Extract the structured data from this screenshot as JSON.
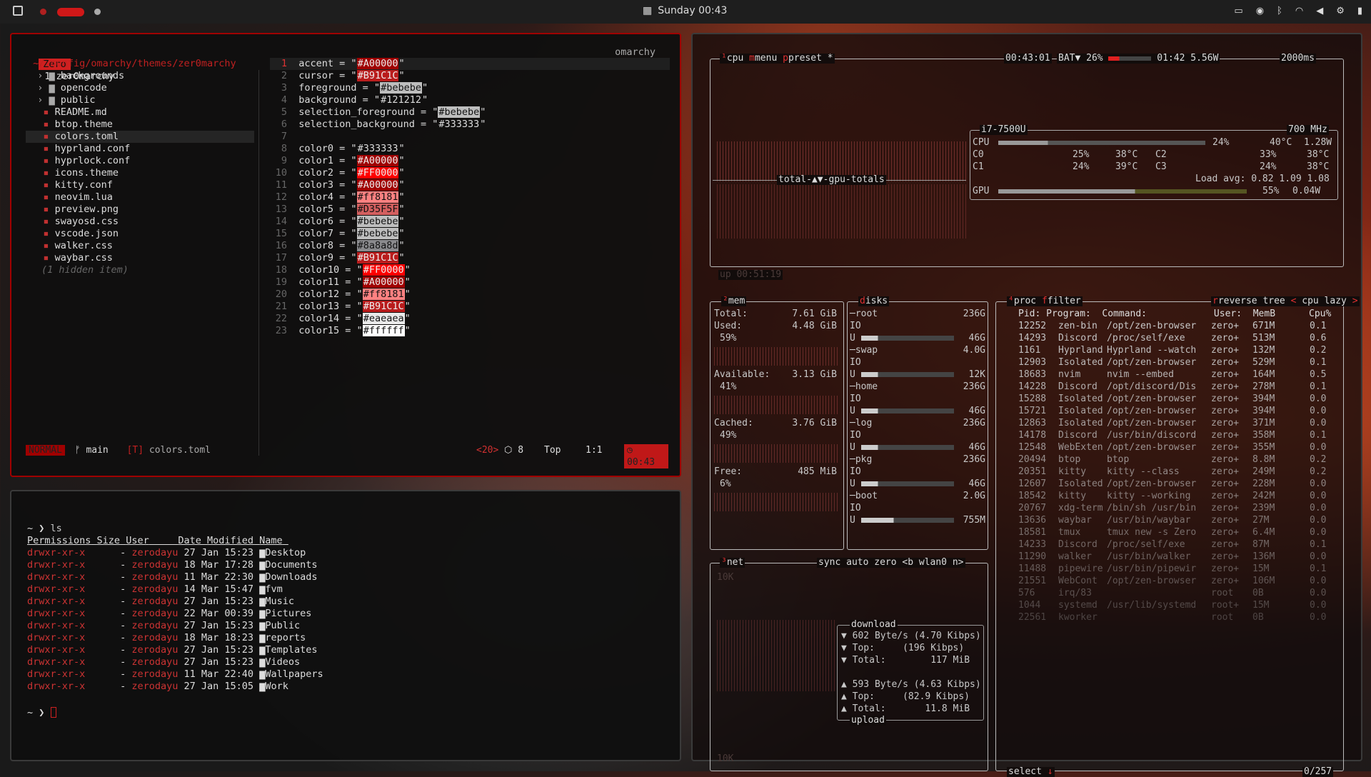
{
  "bar": {
    "clock": "Sunday 00:43"
  },
  "editor": {
    "tab_label": "Zero",
    "tab_title": "1:zer0marchy",
    "right_label": "omarchy",
    "path": " ~/.config/omarchy/themes/zer0marchy",
    "tree": [
      {
        "name": "backgrounds",
        "kind": "dir"
      },
      {
        "name": "opencode",
        "kind": "dir"
      },
      {
        "name": "public",
        "kind": "dir"
      },
      {
        "name": "README.md",
        "kind": "file"
      },
      {
        "name": "btop.theme",
        "kind": "file"
      },
      {
        "name": "colors.toml",
        "kind": "file",
        "sel": true
      },
      {
        "name": "hyprland.conf",
        "kind": "file"
      },
      {
        "name": "hyprlock.conf",
        "kind": "file"
      },
      {
        "name": "icons.theme",
        "kind": "file"
      },
      {
        "name": "kitty.conf",
        "kind": "file"
      },
      {
        "name": "neovim.lua",
        "kind": "file"
      },
      {
        "name": "preview.png",
        "kind": "file"
      },
      {
        "name": "swayosd.css",
        "kind": "file"
      },
      {
        "name": "vscode.json",
        "kind": "file"
      },
      {
        "name": "walker.css",
        "kind": "file"
      },
      {
        "name": "waybar.css",
        "kind": "file"
      }
    ],
    "hidden_note": "(1 hidden item)",
    "lines": [
      {
        "n": "1",
        "k": "accent",
        "v": "#A00000",
        "c": "#A00000"
      },
      {
        "n": "2",
        "k": "cursor",
        "v": "#B91C1C",
        "c": "#B91C1C"
      },
      {
        "n": "3",
        "k": "foreground",
        "v": "#bebebe",
        "c": "#bebebe"
      },
      {
        "n": "4",
        "k": "background",
        "v": "#121212",
        "c": ""
      },
      {
        "n": "5",
        "k": "selection_foreground",
        "v": "#bebebe",
        "c": "#bebebe"
      },
      {
        "n": "6",
        "k": "selection_background",
        "v": "#333333",
        "c": ""
      },
      {
        "n": "7",
        "k": "",
        "v": "",
        "c": ""
      },
      {
        "n": "8",
        "k": "color0",
        "v": "#333333",
        "c": ""
      },
      {
        "n": "9",
        "k": "color1",
        "v": "#A00000",
        "c": "#A00000"
      },
      {
        "n": "10",
        "k": "color2",
        "v": "#FF0000",
        "c": "#FF0000"
      },
      {
        "n": "11",
        "k": "color3",
        "v": "#A00000",
        "c": "#A00000"
      },
      {
        "n": "12",
        "k": "color4",
        "v": "#ff8181",
        "c": "#ff8181"
      },
      {
        "n": "13",
        "k": "color5",
        "v": "#D35F5F",
        "c": "#D35F5F"
      },
      {
        "n": "14",
        "k": "color6",
        "v": "#bebebe",
        "c": "#bebebe"
      },
      {
        "n": "15",
        "k": "color7",
        "v": "#bebebe",
        "c": "#bebebe"
      },
      {
        "n": "16",
        "k": "color8",
        "v": "#8a8a8d",
        "c": "#8a8a8d"
      },
      {
        "n": "17",
        "k": "color9",
        "v": "#B91C1C",
        "c": "#B91C1C"
      },
      {
        "n": "18",
        "k": "color10",
        "v": "#FF0000",
        "c": "#FF0000"
      },
      {
        "n": "19",
        "k": "color11",
        "v": "#A00000",
        "c": "#A00000"
      },
      {
        "n": "20",
        "k": "color12",
        "v": "#ff8181",
        "c": "#ff8181"
      },
      {
        "n": "21",
        "k": "color13",
        "v": "#B91C1C",
        "c": "#B91C1C"
      },
      {
        "n": "22",
        "k": "color14",
        "v": "#eaeaea",
        "c": "#eaeaea"
      },
      {
        "n": "23",
        "k": "color15",
        "v": "#ffffff",
        "c": "#ffffff"
      }
    ],
    "status": {
      "mode": "NORMAL",
      "branch": "main",
      "file": "colors.toml",
      "count": "<20>",
      "lsp": "8",
      "pos": "Top",
      "cursor": "1:1",
      "time": "00:43"
    }
  },
  "term": {
    "cmd": "ls",
    "headers": [
      "Permissions",
      "Size",
      "User",
      "Date Modified",
      "Name"
    ],
    "rows": [
      [
        "drwxr-xr-x",
        "-",
        "zerodayu",
        "27 Jan 15:23",
        "Desktop"
      ],
      [
        "drwxr-xr-x",
        "-",
        "zerodayu",
        "18 Mar 17:28",
        "Documents"
      ],
      [
        "drwxr-xr-x",
        "-",
        "zerodayu",
        "11 Mar 22:30",
        "Downloads"
      ],
      [
        "drwxr-xr-x",
        "-",
        "zerodayu",
        "14 Mar 15:47",
        "fvm"
      ],
      [
        "drwxr-xr-x",
        "-",
        "zerodayu",
        "27 Jan 15:23",
        "Music"
      ],
      [
        "drwxr-xr-x",
        "-",
        "zerodayu",
        "22 Mar 00:39",
        "Pictures"
      ],
      [
        "drwxr-xr-x",
        "-",
        "zerodayu",
        "27 Jan 15:23",
        "Public"
      ],
      [
        "drwxr-xr-x",
        "-",
        "zerodayu",
        "18 Mar 18:23",
        "reports"
      ],
      [
        "drwxr-xr-x",
        "-",
        "zerodayu",
        "27 Jan 15:23",
        "Templates"
      ],
      [
        "drwxr-xr-x",
        "-",
        "zerodayu",
        "27 Jan 15:23",
        "Videos"
      ],
      [
        "drwxr-xr-x",
        "-",
        "zerodayu",
        "11 Mar 22:40",
        "Wallpapers"
      ],
      [
        "drwxr-xr-x",
        "-",
        "zerodayu",
        "27 Jan 15:05",
        "Work"
      ]
    ]
  },
  "btop": {
    "cpu_tabs": [
      "cpu",
      "menu",
      "preset *"
    ],
    "clock": "00:43:01",
    "bat": "BAT▼ 26%",
    "batstat": "01:42 5.56W",
    "interval": "2000ms",
    "cpu_name": "i7-7500U",
    "mhz": "700 MHz",
    "cpu_pct": "24%",
    "cpu_temp": "40°C",
    "cpu_watt": "1.28W",
    "c0": "25%",
    "c0t": "38°C",
    "c1": "24%",
    "c1t": "39°C",
    "c2": "33%",
    "c2t": "38°C",
    "c3": "24%",
    "c3t": "38°C",
    "load": "Load avg: 0.82 1.09 1.08",
    "gpu_pct": "55%",
    "gpu_watt": "0.04W",
    "gpu_label": "total-▲▼-gpu-totals",
    "uptime": "up 00:51:19",
    "mem": {
      "title": "mem",
      "total_l": "Total:",
      "total": "7.61 GiB",
      "used_l": "Used:",
      "used": "4.48 GiB",
      "used_p": "59%",
      "avail_l": "Available:",
      "avail": "3.13 GiB",
      "avail_p": "41%",
      "cached_l": "Cached:",
      "cached": "3.76 GiB",
      "cached_p": "49%",
      "free_l": "Free:",
      "free": "485 MiB",
      "free_p": "6%"
    },
    "disks": [
      {
        "name": "root",
        "size": "236G",
        "used": "46G"
      },
      {
        "name": "swap",
        "size": "4.0G",
        "used": "12K"
      },
      {
        "name": "home",
        "size": "236G",
        "used": "46G"
      },
      {
        "name": "log",
        "size": "236G",
        "used": "46G"
      },
      {
        "name": "pkg",
        "size": "236G",
        "used": "46G"
      },
      {
        "name": "boot",
        "size": "2.0G",
        "used": "755M"
      }
    ],
    "net": {
      "title": "net",
      "tabs": "sync auto zero <b wlan0 n>",
      "down_title": "download",
      "down": "602 Byte/s (4.70 Kibps)",
      "down_top": "(196 Kibps)",
      "down_total": "117 MiB",
      "up": "593 Byte/s (4.63 Kibps)",
      "up_top": "(82.9 Kibps)",
      "up_total": "11.8 MiB",
      "up_title": "upload",
      "scale": "10K"
    },
    "proc": {
      "title": "proc",
      "filter": "filter",
      "reverse": "reverse",
      "tree": "tree",
      "sort": "cpu lazy",
      "headers": "Pid: Program:  Command:            User:  MemB      Cpu%",
      "rows": [
        [
          "12252",
          "zen-bin",
          "/opt/zen-browser",
          "zero+",
          "671M",
          "0.1"
        ],
        [
          "14293",
          "Discord",
          "/proc/self/exe",
          "zero+",
          "513M",
          "0.6"
        ],
        [
          "1161",
          "Hyprland",
          "Hyprland --watch",
          "zero+",
          "132M",
          "0.2"
        ],
        [
          "12903",
          "Isolated",
          "/opt/zen-browser",
          "zero+",
          "529M",
          "0.1"
        ],
        [
          "18683",
          "nvim",
          "nvim --embed",
          "zero+",
          "164M",
          "0.5"
        ],
        [
          "14228",
          "Discord",
          "/opt/discord/Dis",
          "zero+",
          "278M",
          "0.1"
        ],
        [
          "15288",
          "Isolated",
          "/opt/zen-browser",
          "zero+",
          "394M",
          "0.0"
        ],
        [
          "15721",
          "Isolated",
          "/opt/zen-browser",
          "zero+",
          "394M",
          "0.0"
        ],
        [
          "12863",
          "Isolated",
          "/opt/zen-browser",
          "zero+",
          "371M",
          "0.0"
        ],
        [
          "14178",
          "Discord",
          "/usr/bin/discord",
          "zero+",
          "358M",
          "0.1"
        ],
        [
          "12548",
          "WebExten",
          "/opt/zen-browser",
          "zero+",
          "355M",
          "0.0"
        ],
        [
          "20494",
          "btop",
          "btop",
          "zero+",
          "8.8M",
          "0.2"
        ],
        [
          "20351",
          "kitty",
          "kitty --class",
          "zero+",
          "249M",
          "0.2"
        ],
        [
          "12607",
          "Isolated",
          "/opt/zen-browser",
          "zero+",
          "228M",
          "0.0"
        ],
        [
          "18542",
          "kitty",
          "kitty --working",
          "zero+",
          "242M",
          "0.0"
        ],
        [
          "20767",
          "xdg-term",
          "/bin/sh /usr/bin",
          "zero+",
          "239M",
          "0.0"
        ],
        [
          "13636",
          "waybar",
          "/usr/bin/waybar",
          "zero+",
          "27M",
          "0.0"
        ],
        [
          "18581",
          "tmux",
          "tmux new -s Zero",
          "zero+",
          "6.4M",
          "0.0"
        ],
        [
          "14233",
          "Discord",
          "/proc/self/exe",
          "zero+",
          "87M",
          "0.1"
        ],
        [
          "11290",
          "walker",
          "/usr/bin/walker",
          "zero+",
          "136M",
          "0.0"
        ],
        [
          "11488",
          "pipewire",
          "/usr/bin/pipewir",
          "zero+",
          "15M",
          "0.1"
        ],
        [
          "21551",
          "WebCont",
          "/opt/zen-browser",
          "zero+",
          "106M",
          "0.0"
        ],
        [
          "576",
          "irq/83",
          "",
          "root",
          "0B",
          "0.0"
        ],
        [
          "1044",
          "systemd",
          "/usr/lib/systemd",
          "root+",
          "15M",
          "0.0"
        ],
        [
          "22561",
          "kworker",
          "",
          "root",
          "0B",
          "0.0"
        ]
      ],
      "footer_select": "select",
      "footer_count": "0/257"
    }
  }
}
